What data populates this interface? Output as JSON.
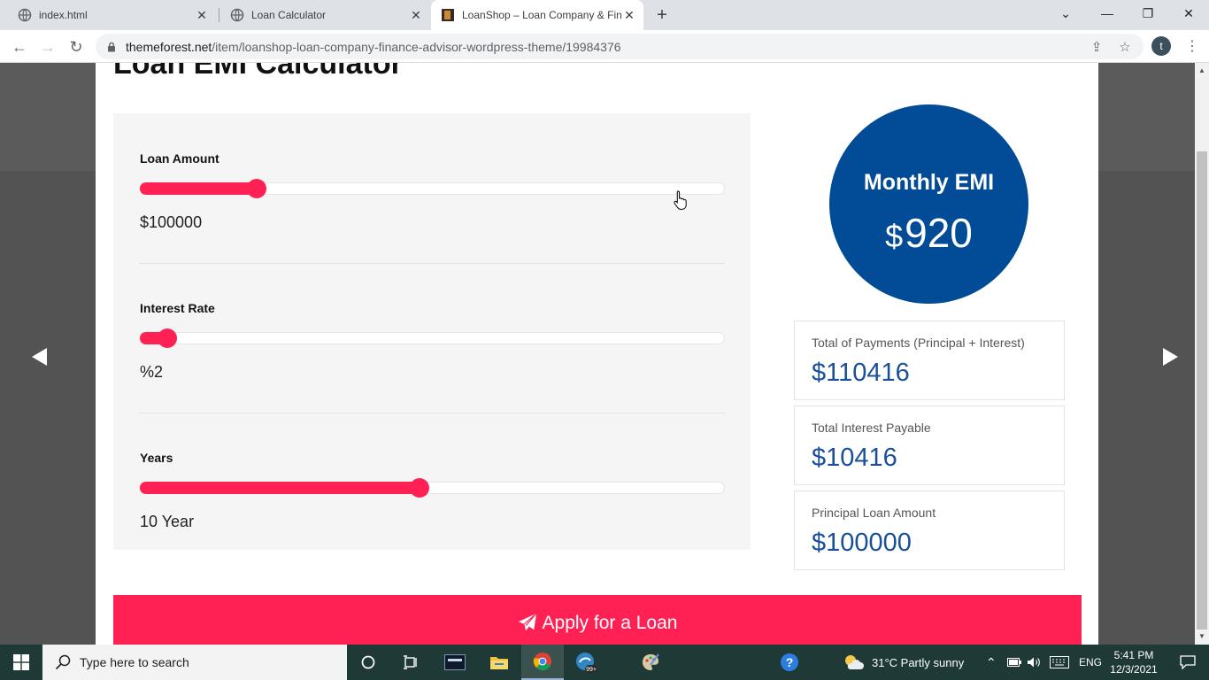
{
  "browser": {
    "tabs": [
      {
        "title": "index.html",
        "active": false
      },
      {
        "title": "Loan Calculator",
        "active": false
      },
      {
        "title": "LoanShop – Loan Company & Fin",
        "active": true
      }
    ],
    "url_host": "themeforest.net",
    "url_path": "/item/loanshop-loan-company-finance-advisor-wordpress-theme/19984376",
    "profile_initial": "t"
  },
  "page": {
    "title": "Loan EMI Calculator",
    "fields": [
      {
        "label": "Loan Amount",
        "value": "$100000",
        "fill_fraction": 0.2
      },
      {
        "label": "Interest Rate",
        "value": "%2",
        "fill_fraction": 0.047
      },
      {
        "label": "Years",
        "value": "10 Year",
        "fill_fraction": 0.477
      }
    ],
    "emi": {
      "label": "Monthly EMI",
      "currency": "$",
      "value": "920"
    },
    "summary": [
      {
        "label": "Total of Payments (Principal + Interest)",
        "value": "$110416"
      },
      {
        "label": "Total Interest Payable",
        "value": "$10416"
      },
      {
        "label": "Principal Loan Amount",
        "value": "$100000"
      }
    ],
    "apply_label": "Apply for a Loan"
  },
  "colors": {
    "accent": "#ff2153",
    "emi_circle": "#024c97",
    "summary_value": "#1a4f99"
  },
  "taskbar": {
    "search_placeholder": "Type here to search",
    "weather": "31°C  Partly sunny",
    "language": "ENG",
    "time": "5:41 PM",
    "date": "12/3/2021"
  }
}
